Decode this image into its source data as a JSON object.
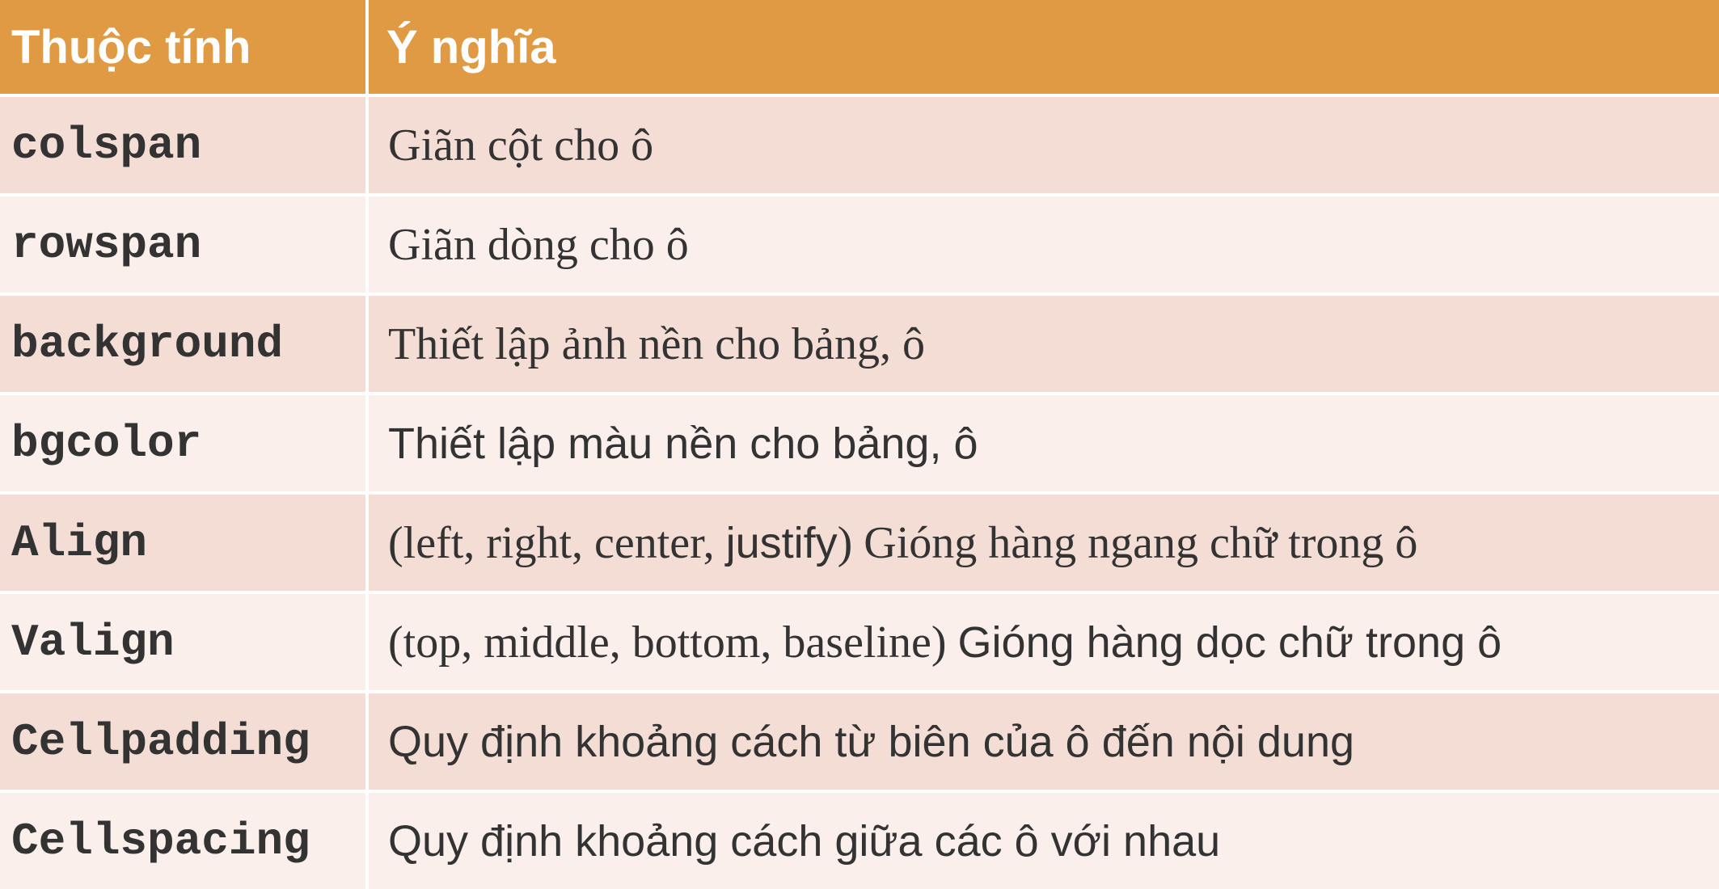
{
  "header": {
    "col1": "Thuộc tính",
    "col2": "Ý nghĩa"
  },
  "rows": [
    {
      "attr": "colspan",
      "serif": "Giãn cột cho ô",
      "sans": ""
    },
    {
      "attr": "rowspan",
      "serif": "Giãn dòng cho ô",
      "sans": ""
    },
    {
      "attr": "background",
      "serif": "Thiết lập ảnh nền cho bảng, ô",
      "sans": ""
    },
    {
      "attr": "bgcolor",
      "serif": "",
      "sans": "Thiết lập màu nền cho bảng, ô"
    },
    {
      "attr": "Align",
      "serif": "(left, right, center, ",
      "sans": "justify",
      "serif_after": ") Gióng hàng ngang chữ trong ô"
    },
    {
      "attr": "Valign",
      "serif": "(top, middle, bottom, baseline) ",
      "sans": "Gióng hàng dọc chữ trong ô"
    },
    {
      "attr": "Cellpadding",
      "serif": "",
      "sans": "Quy định khoảng cách từ biên của ô đến nội dung"
    },
    {
      "attr": "Cellspacing",
      "serif": "",
      "sans": "Quy định khoảng cách giữa các ô với nhau"
    }
  ],
  "colors": {
    "header_bg": "#e09a43",
    "row_odd_bg": "#f3ddd4",
    "row_even_bg": "#faefeb",
    "text": "#333333"
  }
}
